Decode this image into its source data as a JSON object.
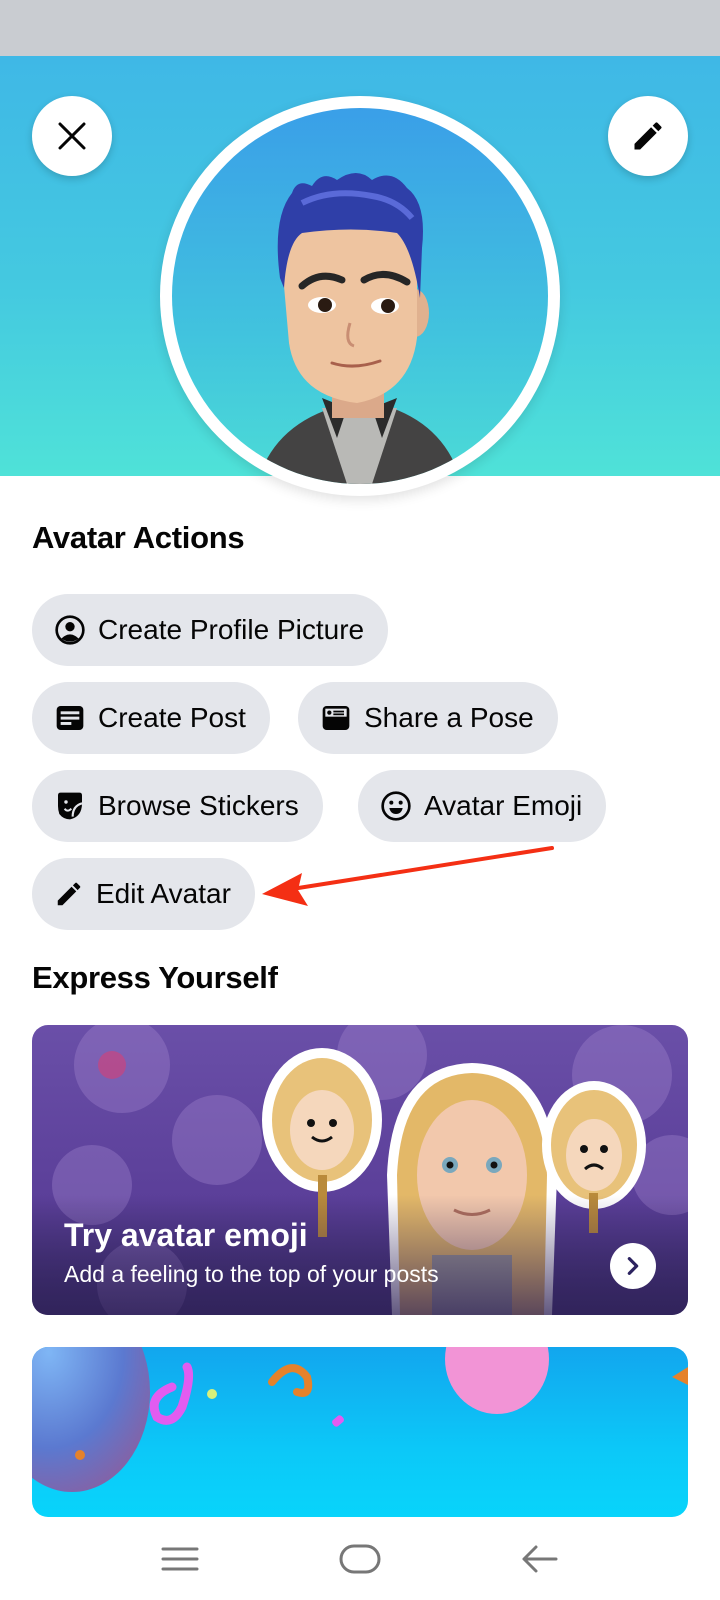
{
  "header": {
    "close_icon": "close-icon",
    "edit_icon": "pencil-icon"
  },
  "avatar_actions": {
    "title": "Avatar Actions",
    "buttons": [
      {
        "label": "Create Profile Picture",
        "icon": "profile-circle-icon"
      },
      {
        "label": "Create Post",
        "icon": "post-icon"
      },
      {
        "label": "Share a Pose",
        "icon": "pose-card-icon"
      },
      {
        "label": "Browse Stickers",
        "icon": "sticker-icon"
      },
      {
        "label": "Avatar Emoji",
        "icon": "smile-icon"
      },
      {
        "label": "Edit Avatar",
        "icon": "pencil-icon"
      }
    ]
  },
  "express_yourself": {
    "title": "Express Yourself",
    "cards": [
      {
        "title": "Try avatar emoji",
        "subtitle": "Add a feeling to the top of your posts",
        "icon": "chevron-right-icon"
      },
      {
        "title": "",
        "subtitle": ""
      }
    ]
  },
  "annotation": {
    "color": "#f42f14",
    "target": "Edit Avatar"
  },
  "colors": {
    "chip_bg": "#e4e6eb",
    "header_top": "#3fb8e6",
    "header_bottom": "#4fe2d8"
  }
}
